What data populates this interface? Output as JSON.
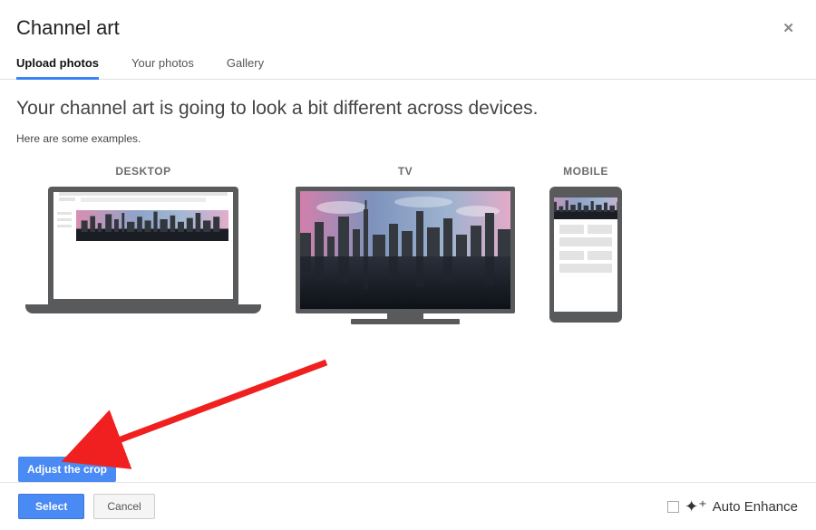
{
  "header": {
    "title": "Channel art"
  },
  "tabs": {
    "items": [
      {
        "label": "Upload photos"
      },
      {
        "label": "Your photos"
      },
      {
        "label": "Gallery"
      }
    ]
  },
  "content": {
    "heading": "Your channel art is going to look a bit different across devices.",
    "subtext": "Here are some examples."
  },
  "devices": {
    "desktop": {
      "label": "DESKTOP"
    },
    "tv": {
      "label": "TV"
    },
    "mobile": {
      "label": "MOBILE"
    }
  },
  "actions": {
    "adjust_crop": "Adjust the crop",
    "select": "Select",
    "cancel": "Cancel"
  },
  "auto_enhance": {
    "label": "Auto Enhance"
  }
}
